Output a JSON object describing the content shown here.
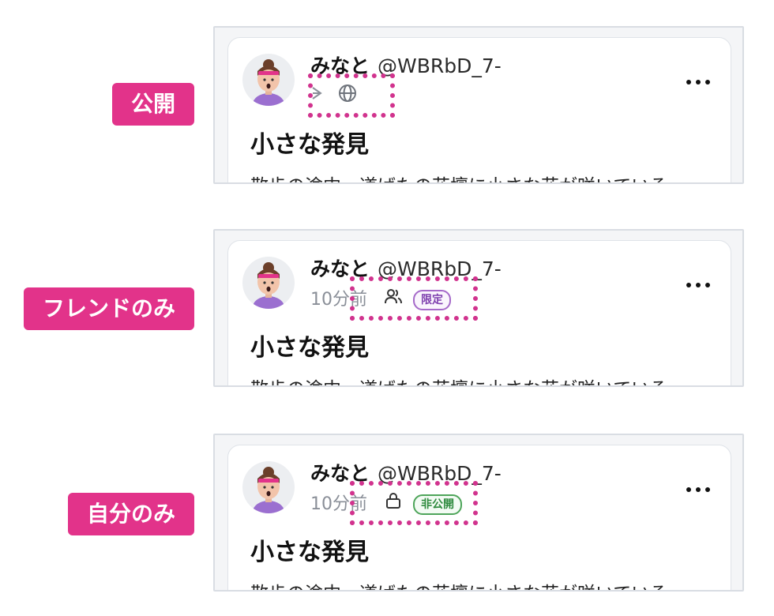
{
  "posts": [
    {
      "visibility_label": "公開",
      "display_name": "みなと",
      "handle": "@WBRbD_7-",
      "time": "",
      "visibility_icon": "globe-icon",
      "badge": "",
      "title": "小さな発見",
      "body": "散歩の途中、道ばたの花壇に小さな花が咲いている"
    },
    {
      "visibility_label": "フレンドのみ",
      "display_name": "みなと",
      "handle": "@WBRbD_7-",
      "time": "10分前",
      "visibility_icon": "users-icon",
      "badge": "限定",
      "title": "小さな発見",
      "body": "散歩の途中、道ばたの花壇に小さな花が咲いている"
    },
    {
      "visibility_label": "自分のみ",
      "display_name": "みなと",
      "handle": "@WBRbD_7-",
      "time": "10分前",
      "visibility_icon": "lock-icon",
      "badge": "非公開",
      "title": "小さな発見",
      "body": "散歩の途中、道ばたの花壇に小さな花が咲いている"
    }
  ],
  "colors": {
    "accent": "#e2338a",
    "highlight": "#d1338e",
    "badge_friends": "#7e3fae",
    "badge_private": "#2e8a3e"
  }
}
